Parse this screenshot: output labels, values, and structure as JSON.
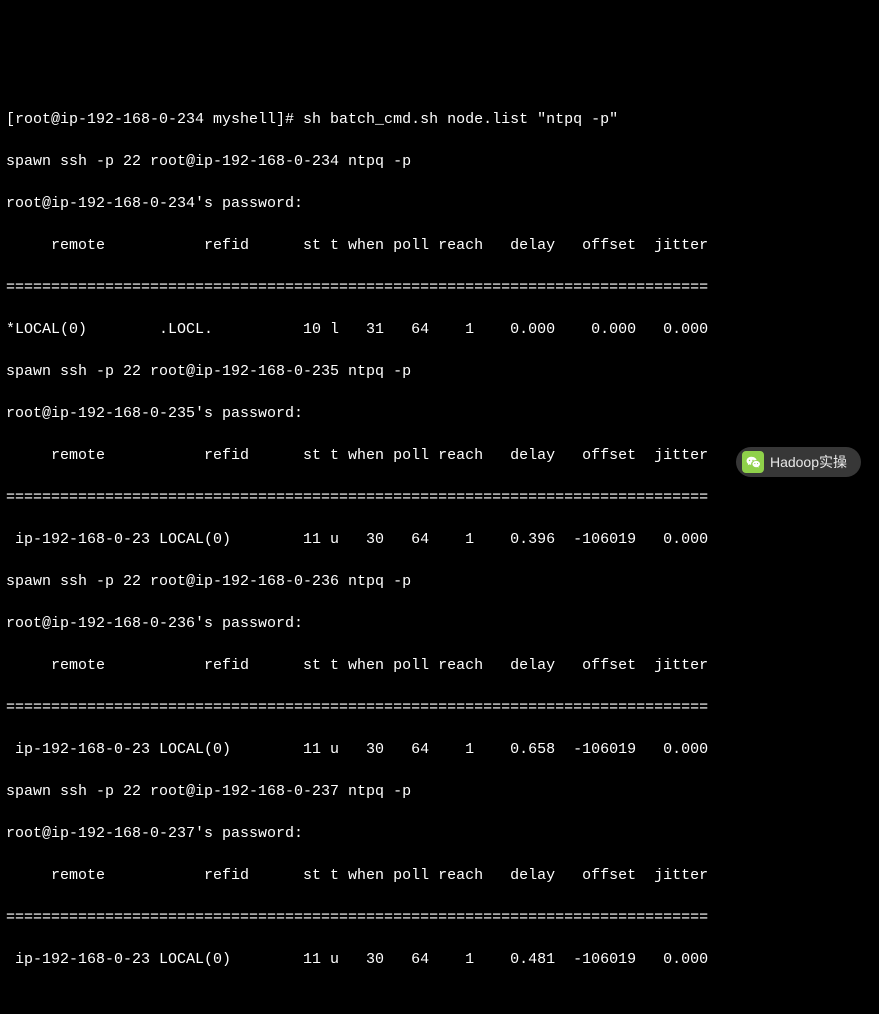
{
  "prompt": "[root@ip-192-168-0-234 myshell]# sh batch_cmd.sh node.list \"ntpq -p\"",
  "divider": "==============================================================================",
  "header": "     remote           refid      st t when poll reach   delay   offset  jitter",
  "hosts": [
    {
      "spawn": "spawn ssh -p 22 root@ip-192-168-0-234 ntpq -p",
      "password": "root@ip-192-168-0-234's password:",
      "row": "*LOCAL(0)        .LOCL.          10 l   31   64    1    0.000    0.000   0.000"
    },
    {
      "spawn": "spawn ssh -p 22 root@ip-192-168-0-235 ntpq -p",
      "password": "root@ip-192-168-0-235's password:",
      "row": " ip-192-168-0-23 LOCAL(0)        11 u   30   64    1    0.396  -106019   0.000"
    },
    {
      "spawn": "spawn ssh -p 22 root@ip-192-168-0-236 ntpq -p",
      "password": "root@ip-192-168-0-236's password:",
      "row": " ip-192-168-0-23 LOCAL(0)        11 u   30   64    1    0.658  -106019   0.000"
    },
    {
      "spawn": "spawn ssh -p 22 root@ip-192-168-0-237 ntpq -p",
      "password": "root@ip-192-168-0-237's password:",
      "row": " ip-192-168-0-23 LOCAL(0)        11 u   30   64    1    0.481  -106019   0.000"
    }
  ],
  "watermark": {
    "text": "Hadoop实操"
  }
}
